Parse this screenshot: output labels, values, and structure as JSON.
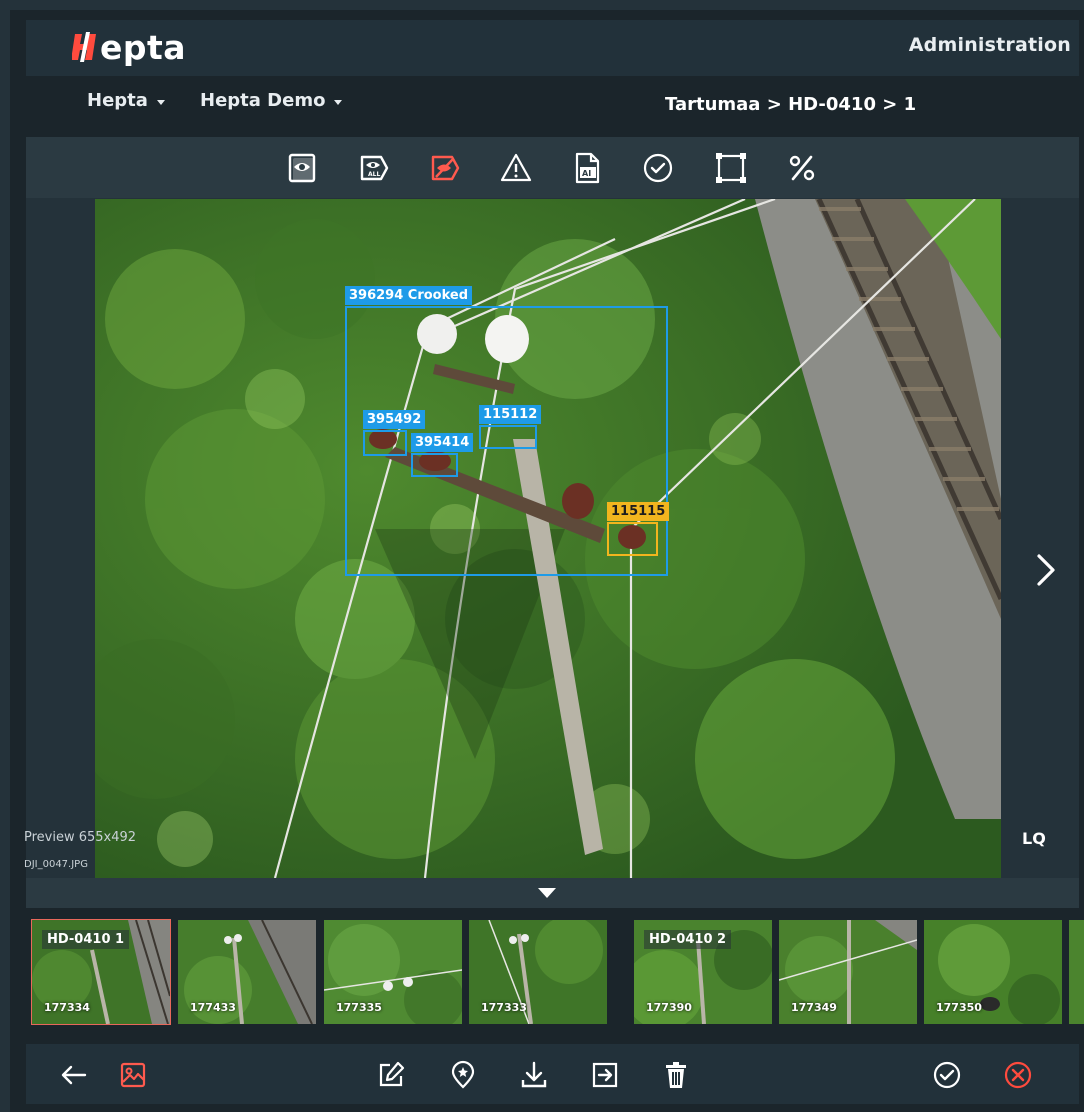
{
  "brand": {
    "logo_text": "epta",
    "accent_color": "#ff4b3e"
  },
  "header": {
    "admin_link": "Administration"
  },
  "nav": {
    "org_dropdown": "Hepta",
    "project_dropdown": "Hepta Demo",
    "breadcrumb": "Tartumaa > HD-0410 > 1"
  },
  "toolbar": {
    "tools": [
      {
        "name": "view-single-icon",
        "color": "#ffffff"
      },
      {
        "name": "view-all-icon",
        "color": "#ffffff"
      },
      {
        "name": "hide-labels-icon",
        "color": "#ff5a4e",
        "active": true
      },
      {
        "name": "warning-icon",
        "color": "#ffffff"
      },
      {
        "name": "ai-file-icon",
        "color": "#ffffff"
      },
      {
        "name": "check-circle-icon",
        "color": "#ffffff"
      },
      {
        "name": "bounding-box-icon",
        "color": "#ffffff"
      },
      {
        "name": "percent-icon",
        "color": "#ffffff"
      }
    ]
  },
  "viewer": {
    "detections": [
      {
        "label": "396294 Crooked",
        "color": "#1e9be8"
      },
      {
        "label": "395492",
        "color": "#1e9be8"
      },
      {
        "label": "395414",
        "color": "#1e9be8"
      },
      {
        "label": "115112",
        "color": "#1e9be8"
      },
      {
        "label": "115115",
        "color": "#f2b51e"
      }
    ],
    "preview_info": "Preview 655x492",
    "file_name": "DJI_0047.JPG",
    "quality": "LQ"
  },
  "filmstrip": {
    "thumbnails": [
      {
        "group": "HD-0410 1",
        "id": "177334",
        "selected": true
      },
      {
        "group": "",
        "id": "177433",
        "selected": false
      },
      {
        "group": "",
        "id": "177335",
        "selected": false
      },
      {
        "group": "",
        "id": "177333",
        "selected": false
      },
      {
        "group": "HD-0410 2",
        "id": "177390",
        "selected": false
      },
      {
        "group": "",
        "id": "177349",
        "selected": false
      },
      {
        "group": "",
        "id": "177350",
        "selected": false
      }
    ]
  },
  "bottom_actions": {
    "left": [
      "back-arrow-icon",
      "image-icon"
    ],
    "center": [
      "edit-icon",
      "location-pin-icon",
      "download-icon",
      "export-icon",
      "trash-icon"
    ],
    "right": [
      "approve-check-icon",
      "reject-close-icon"
    ],
    "reject_color": "#ff4b3e",
    "image_icon_color": "#ff5a4e"
  }
}
